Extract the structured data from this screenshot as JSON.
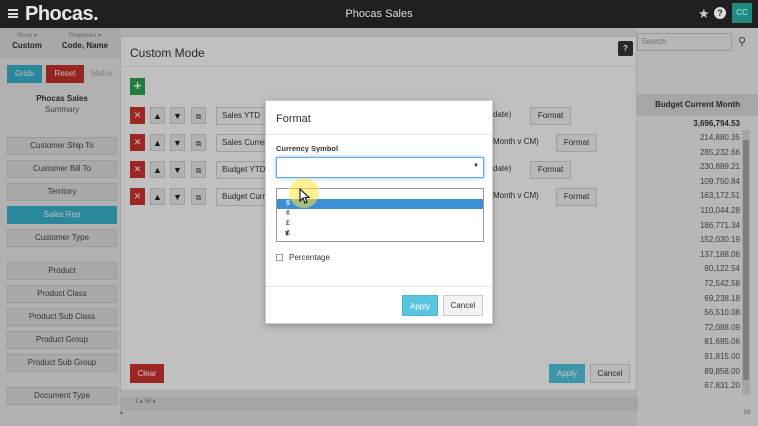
{
  "app": {
    "logo": "Phocas.",
    "title": "Phocas Sales",
    "avatar_initials": "CC",
    "colors": {
      "topbar": "#1f1f1f",
      "accent": "#3ab6d0",
      "danger": "#c9302c",
      "success": "#2e9e52"
    }
  },
  "selectors": [
    {
      "sub": "Show ▾",
      "main": "Custom"
    },
    {
      "sub": "Properties ▾",
      "main": "Code, Name"
    }
  ],
  "toolbar": {
    "grid_label": "Grids",
    "reset_label": "Reset",
    "matrix_label": "Matrix"
  },
  "summary": {
    "title": "Phocas Sales",
    "subtitle": "Summary"
  },
  "dimensions": [
    "Customer Ship To",
    "Customer Bill To",
    "Territory",
    "Sales Rep",
    "Customer Type",
    "Product",
    "Product Class",
    "Product Sub Class",
    "Product Group",
    "Product Sub Group",
    "Document Type"
  ],
  "search": {
    "placeholder": "Search"
  },
  "grid": {
    "column_header": "Budget Current Month",
    "total": "3,696,794.53",
    "values": [
      "214,880.35",
      "285,232.66",
      "230,889.21",
      "109,750.84",
      "163,172.51",
      "110,044.28",
      "186,771.34",
      "152,030.19",
      "137,188.06",
      "80,122.54",
      "72,542.58",
      "69,238.18",
      "56,510.08",
      "72,088.09",
      "81,685.06",
      "91,815.00",
      "89,858.00",
      "67,831.20"
    ],
    "pager": "1 ▸  50 ▸",
    "count": "58"
  },
  "custom_mode": {
    "title": "Custom Mode",
    "rows": [
      {
        "measure": "Sales YTD",
        "tail": "date)",
        "format_label": "Format"
      },
      {
        "measure": "Sales Current Month",
        "tail": "Month v CM)",
        "format_label": "Format"
      },
      {
        "measure": "Budget YTD",
        "tail": "date)",
        "format_label": "Format"
      },
      {
        "measure": "Budget Current Month",
        "tail": "Month v CM)",
        "format_label": "Format"
      }
    ],
    "clear_label": "Clear",
    "apply_label": "Apply",
    "cancel_label": "Cancel"
  },
  "format_dialog": {
    "title": "Format",
    "currency_label": "Currency Symbol",
    "currency_value": "",
    "options": [
      "",
      "$",
      "¢",
      "£",
      "€",
      "¥"
    ],
    "highlighted_option": "$",
    "percentage_label": "Percentage",
    "percentage_checked": false,
    "apply_label": "Apply",
    "cancel_label": "Cancel"
  }
}
